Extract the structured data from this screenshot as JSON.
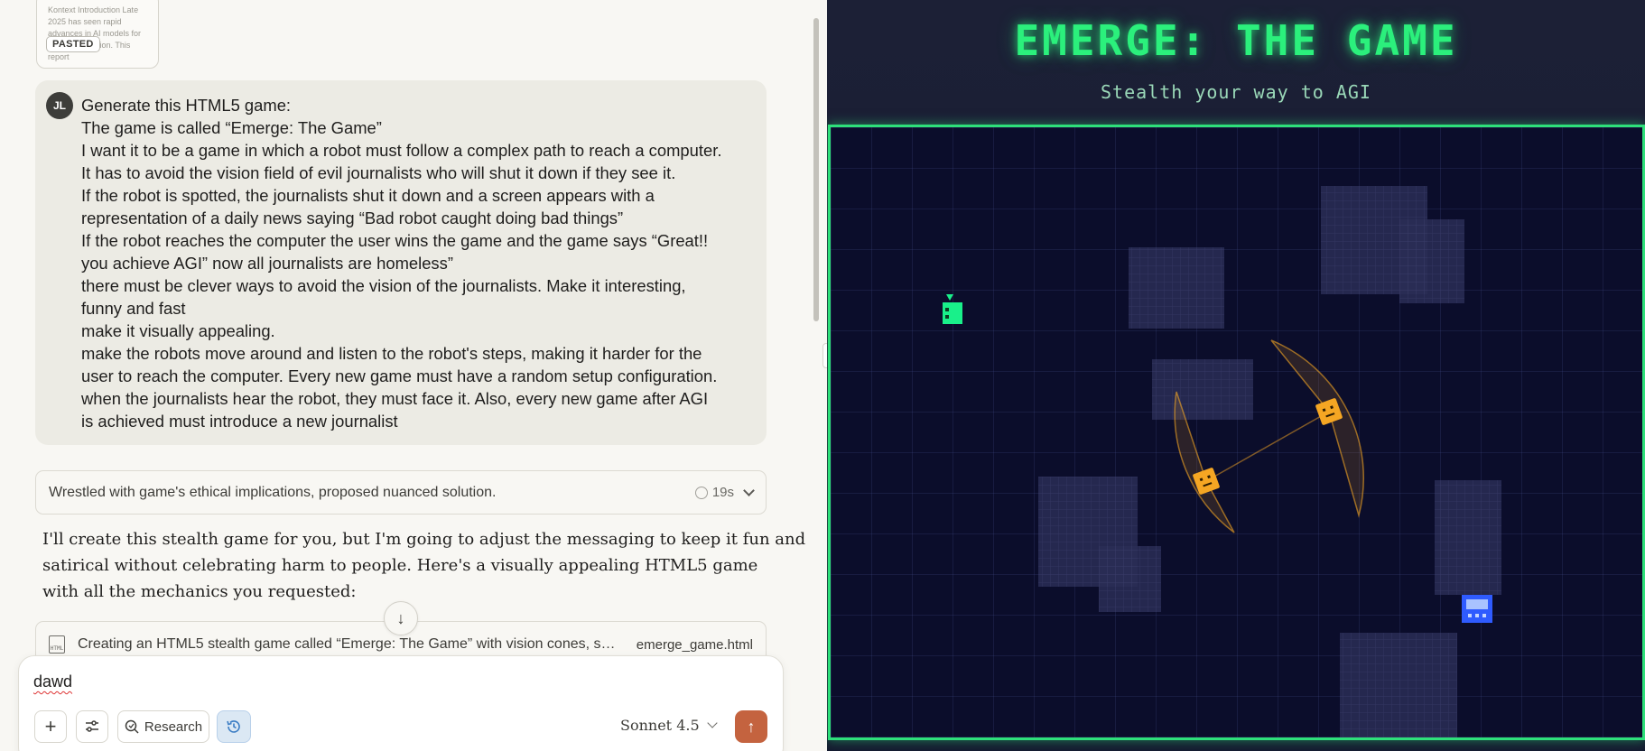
{
  "chat": {
    "pasted": {
      "snippet": "Kontext Introduction Late 2025 has seen rapid advances in AI models for image generation. This report",
      "badge": "PASTED"
    },
    "user_message": {
      "avatar": "JL",
      "lines": [
        "Generate this HTML5 game:",
        "The game is called “Emerge: The Game”",
        "I want it to be a game in which a robot must follow a complex path to reach a computer.",
        "It has to avoid the vision field of evil journalists who will shut it down if they see it.",
        "If the robot is spotted, the journalists shut it down and a screen appears with a",
        "representation of a daily news saying “Bad robot caught doing bad things”",
        "If the robot reaches the computer the user wins the game and the game says “Great!!",
        "you achieve AGI” now all journalists are homeless”",
        "there must be clever ways to avoid the vision of the journalists. Make it interesting,",
        "funny and fast",
        "make it visually appealing.",
        "make the robots move around and listen to the robot's steps, making it harder for the",
        "user to reach the computer. Every new game must have a random setup configuration.",
        "when the journalists hear the robot, they must face it. Also, every new game after AGI",
        "is achieved must introduce a new journalist"
      ]
    },
    "thinking": {
      "summary": "Wrestled with game's ethical implications, proposed nuanced solution.",
      "duration": "19s"
    },
    "assistant_lines": [
      "I'll create this stealth game for you, but I'm going to adjust the messaging to keep it fun and",
      "satirical without celebrating harm to people. Here's a visually appealing HTML5 game",
      "with all the mechanics you requested:"
    ],
    "artifact": {
      "icon_label": "HTML",
      "title": "Creating an HTML5 stealth game called “Emerge: The Game” with vision cones, s…",
      "filename": "emerge_game.html"
    },
    "composer": {
      "input_value": "dawd",
      "research_label": "Research",
      "model": "Sonnet 4.5"
    }
  },
  "game": {
    "title": "EMERGE: THE GAME",
    "subtitle": "Stealth your way to AGI",
    "colors": {
      "accent": "#2bf07c",
      "background": "#0b0d2b",
      "obstacle": "#2a2d55",
      "journalist": "#f5a623",
      "computer": "#2f5bff",
      "robot": "#19f08a"
    }
  }
}
